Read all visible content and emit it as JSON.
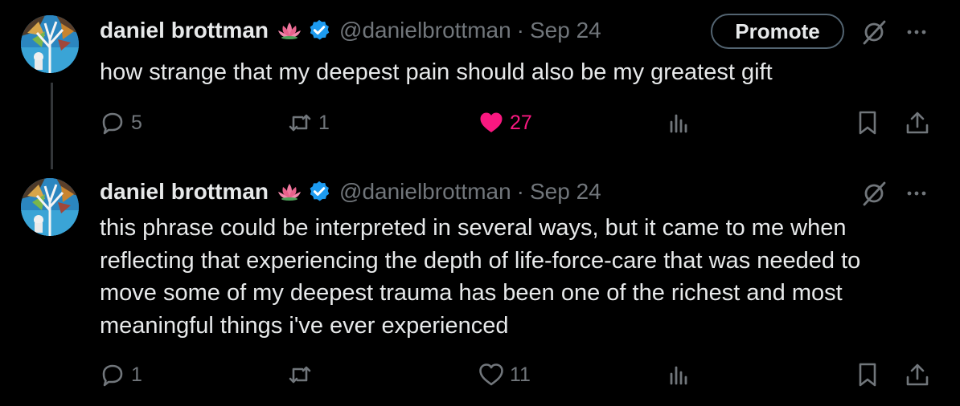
{
  "tweets": [
    {
      "author_name": "daniel brottman",
      "author_emoji": "lotus",
      "verified": true,
      "handle": "@danielbrottman",
      "separator": "·",
      "date": "Sep 24",
      "promote_label": "Promote",
      "text": "how strange that my deepest pain should also be my greatest gift",
      "replies": "5",
      "retweets": "1",
      "likes": "27",
      "liked": true
    },
    {
      "author_name": "daniel brottman",
      "author_emoji": "lotus",
      "verified": true,
      "handle": "@danielbrottman",
      "separator": "·",
      "date": "Sep 24",
      "text": "this phrase could be interpreted in several ways, but it came to me when\nreflecting that experiencing the depth of life-force-care that was needed to\nmove some of my deepest trauma has been one of the richest and most\nmeaningful things i've ever experienced",
      "replies": "1",
      "retweets": "",
      "likes": "11",
      "liked": false
    }
  ],
  "colors": {
    "background": "#000000",
    "text": "#e7e9ea",
    "muted": "#71767b",
    "verified": "#1d9bf0",
    "like": "#f91880"
  },
  "icons": [
    "avatar-image",
    "lotus-emoji",
    "verified-badge-icon",
    "grok-icon",
    "more-icon",
    "reply-icon",
    "retweet-icon",
    "like-icon",
    "views-icon",
    "bookmark-icon",
    "share-icon"
  ]
}
